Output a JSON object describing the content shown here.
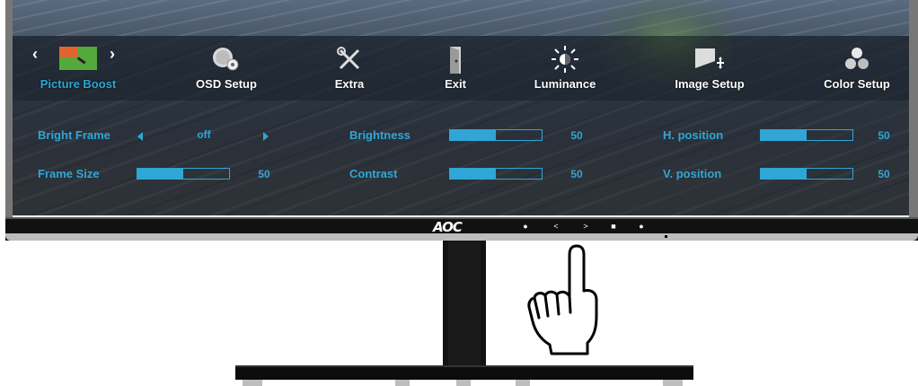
{
  "menu": {
    "items": [
      {
        "label": "Picture Boost",
        "icon": "picture-boost-icon",
        "active": true
      },
      {
        "label": "OSD Setup",
        "icon": "osd-setup-icon"
      },
      {
        "label": "Extra",
        "icon": "extra-tools-icon"
      },
      {
        "label": "Exit",
        "icon": "exit-door-icon"
      },
      {
        "label": "Luminance",
        "icon": "luminance-sun-icon"
      },
      {
        "label": "Image Setup",
        "icon": "image-setup-icon"
      },
      {
        "label": "Color Setup",
        "icon": "color-setup-icon"
      }
    ],
    "accent_color": "#2fa6d6"
  },
  "settings": {
    "bright_frame": {
      "label": "Bright Frame",
      "value": "off"
    },
    "frame_size": {
      "label": "Frame Size",
      "value": "50",
      "level": 0.5
    },
    "brightness": {
      "label": "Brightness",
      "value": "50",
      "level": 0.5
    },
    "contrast": {
      "label": "Contrast",
      "value": "50",
      "level": 0.5
    },
    "h_position": {
      "label": "H. position",
      "value": "50",
      "level": 0.5
    },
    "v_position": {
      "label": "V. position",
      "value": "50",
      "level": 0.5
    }
  },
  "bezel": {
    "logo": "AOC",
    "buttons": [
      "●",
      "<",
      ">",
      "■",
      "●"
    ]
  }
}
